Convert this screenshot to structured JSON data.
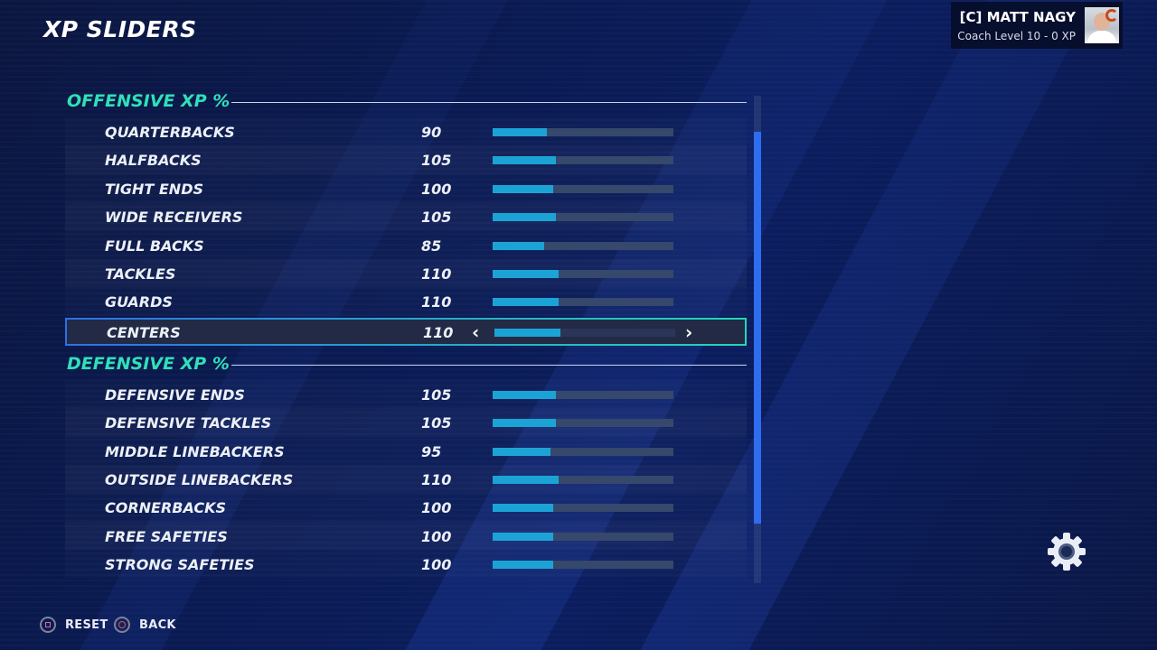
{
  "page": {
    "title": "XP SLIDERS"
  },
  "profile": {
    "name": "[C] MATT NAGY",
    "level": "Coach Level 10 - 0 XP"
  },
  "sections": [
    {
      "title": "OFFENSIVE XP %",
      "rows": [
        {
          "label": "QUARTERBACKS",
          "value": "90",
          "fill": 0.3
        },
        {
          "label": "HALFBACKS",
          "value": "105",
          "fill": 0.35
        },
        {
          "label": "TIGHT ENDS",
          "value": "100",
          "fill": 0.335
        },
        {
          "label": "WIDE RECEIVERS",
          "value": "105",
          "fill": 0.35
        },
        {
          "label": "FULL BACKS",
          "value": "85",
          "fill": 0.285
        },
        {
          "label": "TACKLES",
          "value": "110",
          "fill": 0.365
        },
        {
          "label": "GUARDS",
          "value": "110",
          "fill": 0.365
        },
        {
          "label": "CENTERS",
          "value": "110",
          "fill": 0.365,
          "selected": true
        }
      ]
    },
    {
      "title": "DEFENSIVE XP %",
      "rows": [
        {
          "label": "DEFENSIVE ENDS",
          "value": "105",
          "fill": 0.35
        },
        {
          "label": "DEFENSIVE TACKLES",
          "value": "105",
          "fill": 0.35
        },
        {
          "label": "MIDDLE LINEBACKERS",
          "value": "95",
          "fill": 0.32
        },
        {
          "label": "OUTSIDE LINEBACKERS",
          "value": "110",
          "fill": 0.365
        },
        {
          "label": "CORNERBACKS",
          "value": "100",
          "fill": 0.335
        },
        {
          "label": "FREE SAFETIES",
          "value": "100",
          "fill": 0.335
        },
        {
          "label": "STRONG SAFETIES",
          "value": "100",
          "fill": 0.335
        }
      ]
    }
  ],
  "selected_arrows": {
    "left": "‹",
    "right": "›"
  },
  "footer": {
    "reset_label": "RESET",
    "back_label": "BACK"
  },
  "colors": {
    "accent_teal": "#2fe0b9",
    "bar_fill": "#1ca3d6",
    "scroll_thumb": "#2f6df0"
  },
  "icons": {
    "settings": "gear-icon",
    "reset": "square-button-icon",
    "back": "circle-button-icon"
  }
}
